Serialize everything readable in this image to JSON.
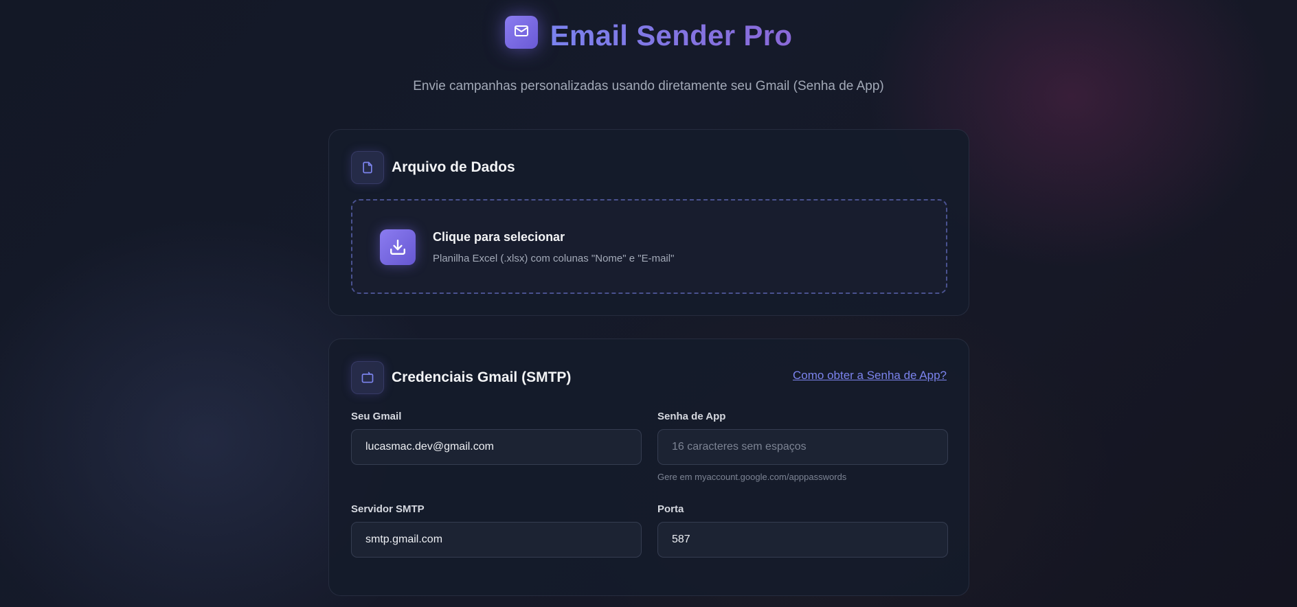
{
  "app": {
    "title": "Email Sender Pro",
    "subtitle": "Envie campanhas personalizadas usando diretamente seu Gmail (Senha de App)",
    "logo_icon": "mail-icon"
  },
  "file_card": {
    "title": "Arquivo de Dados",
    "icon": "file-icon",
    "dropzone": {
      "icon": "download-icon",
      "title": "Clique para selecionar",
      "description": "Planilha Excel (.xlsx) com colunas \"Nome\" e \"E-mail\""
    }
  },
  "smtp_card": {
    "title": "Credenciais Gmail (SMTP)",
    "icon": "cast-icon",
    "help_link": "Como obter a Senha de App?",
    "fields": {
      "gmail": {
        "label": "Seu Gmail",
        "value": "lucasmac.dev@gmail.com",
        "placeholder": ""
      },
      "app_password": {
        "label": "Senha de App",
        "value": "",
        "placeholder": "16 caracteres sem espaços",
        "hint": "Gere em myaccount.google.com/apppasswords"
      },
      "smtp_server": {
        "label": "Servidor SMTP",
        "value": "smtp.gmail.com"
      },
      "port": {
        "label": "Porta",
        "value": "587"
      }
    }
  },
  "colors": {
    "accent": "#7b82ee",
    "accent_purple": "#8a69d8",
    "background": "#141a28",
    "card": "#151b2a"
  }
}
